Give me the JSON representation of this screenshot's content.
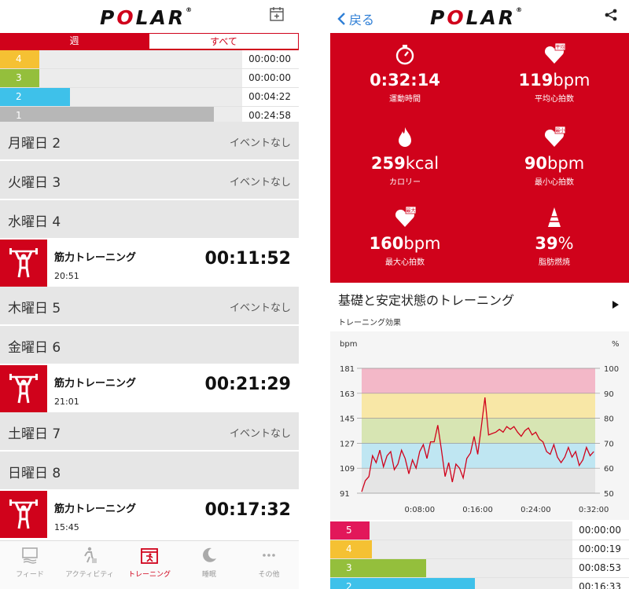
{
  "colors": {
    "brand": "#d0021b",
    "zone5": "#e2175a",
    "zone4": "#f5c133",
    "zone3": "#94bf3c",
    "zone2": "#3ec1ea",
    "zone1": "#b7b7b7"
  },
  "left": {
    "header": {
      "logo": "POLAR",
      "calendar_icon": "calendar-add-icon"
    },
    "tabs": [
      {
        "label": "週",
        "active": true
      },
      {
        "label": "すべて",
        "active": false
      }
    ],
    "zones": [
      {
        "zone": "4",
        "time": "00:00:00",
        "fraction": 0.0
      },
      {
        "zone": "3",
        "time": "00:00:00",
        "fraction": 0.0
      },
      {
        "zone": "2",
        "time": "00:04:22",
        "fraction": 0.15
      },
      {
        "zone": "1",
        "time": "00:24:58",
        "fraction": 0.86
      }
    ],
    "days": [
      {
        "label": "月曜日 2",
        "status": "イベントなし"
      },
      {
        "label": "火曜日 3",
        "status": "イベントなし"
      },
      {
        "label": "水曜日 4"
      },
      {
        "label": "木曜日 5",
        "status": "イベントなし"
      },
      {
        "label": "金曜日 6"
      },
      {
        "label": "土曜日 7",
        "status": "イベントなし"
      },
      {
        "label": "日曜日 8"
      }
    ],
    "sessions": [
      {
        "name": "筋力トレーニング",
        "start": "20:51",
        "duration": "00:11:52"
      },
      {
        "name": "筋力トレーニング",
        "start": "21:01",
        "duration": "00:21:29"
      },
      {
        "name": "筋力トレーニング",
        "start": "15:45",
        "duration": "00:17:32"
      }
    ],
    "nav": [
      {
        "label": "フィード",
        "icon": "feed-icon",
        "active": false
      },
      {
        "label": "アクティビティ",
        "icon": "activity-icon",
        "active": false
      },
      {
        "label": "トレーニング",
        "icon": "training-icon",
        "active": true
      },
      {
        "label": "睡眠",
        "icon": "sleep-icon",
        "active": false
      },
      {
        "label": "その他",
        "icon": "more-icon",
        "active": false
      }
    ]
  },
  "right": {
    "header": {
      "back": "戻る",
      "logo": "POLAR",
      "share_icon": "share-icon"
    },
    "stats": [
      {
        "icon": "stopwatch-icon",
        "value": "0:32:14",
        "unit": "",
        "label": "運動時間"
      },
      {
        "icon": "heart-average-icon",
        "badge": "平均",
        "value": "119",
        "unit": "bpm",
        "label": "平均心拍数"
      },
      {
        "icon": "flame-icon",
        "value": "259",
        "unit": "kcal",
        "label": "カロリー"
      },
      {
        "icon": "heart-min-icon",
        "badge": "最小",
        "value": "90",
        "unit": "bpm",
        "label": "最小心拍数"
      },
      {
        "icon": "heart-max-icon",
        "badge": "最大",
        "value": "160",
        "unit": "bpm",
        "label": "最大心拍数"
      },
      {
        "icon": "fat-burn-icon",
        "value": "39",
        "unit": "%",
        "label": "脂肪燃焼"
      }
    ],
    "training_title": "基礎と安定状態のトレーニング",
    "training_sub": "トレーニング効果",
    "zones": [
      {
        "zone": "5",
        "time": "00:00:00",
        "fraction": 0.0
      },
      {
        "zone": "4",
        "time": "00:00:19",
        "fraction": 0.01
      },
      {
        "zone": "3",
        "time": "00:08:53",
        "fraction": 0.28
      },
      {
        "zone": "2",
        "time": "00:16:33",
        "fraction": 0.52
      }
    ]
  },
  "chart_data": {
    "type": "line",
    "ylabel": "bpm",
    "ylabel_right": "%",
    "y_ticks": [
      91,
      109,
      127,
      145,
      163,
      181
    ],
    "y_ticks_right": [
      50,
      60,
      70,
      80,
      90,
      100
    ],
    "x_ticks": [
      "0:08:00",
      "0:16:00",
      "0:24:00",
      "0:32:00"
    ],
    "ylim": [
      91,
      181
    ],
    "xlim_minutes": [
      0,
      32.2
    ],
    "zones_bpm": [
      {
        "from": 163,
        "to": 181,
        "color": "#f3b8c8"
      },
      {
        "from": 145,
        "to": 163,
        "color": "#f8e7a6"
      },
      {
        "from": 127,
        "to": 145,
        "color": "#d7e5b3"
      },
      {
        "from": 109,
        "to": 127,
        "color": "#bfe6f2"
      },
      {
        "from": 91,
        "to": 109,
        "color": "#e5e5e5"
      }
    ],
    "series": [
      {
        "color": "#d0021b",
        "x_minutes": [
          0,
          0.5,
          1,
          1.5,
          2,
          2.5,
          3,
          3.5,
          4,
          4.5,
          5,
          5.5,
          6,
          6.5,
          7,
          7.5,
          8,
          8.5,
          9,
          9.5,
          10,
          10.5,
          11,
          11.5,
          12,
          12.5,
          13,
          13.5,
          14,
          14.5,
          15,
          15.5,
          16,
          16.5,
          17,
          17.5,
          18,
          18.5,
          19,
          19.5,
          20,
          20.5,
          21,
          21.5,
          22,
          22.5,
          23,
          23.5,
          24,
          24.5,
          25,
          25.5,
          26,
          26.5,
          27,
          27.5,
          28,
          28.5,
          29,
          29.5,
          30,
          30.5,
          31,
          31.5,
          32
        ],
        "values": [
          92,
          100,
          103,
          118,
          113,
          122,
          110,
          118,
          121,
          108,
          112,
          122,
          116,
          105,
          115,
          109,
          121,
          126,
          116,
          128,
          128,
          140,
          122,
          103,
          113,
          99,
          112,
          109,
          102,
          116,
          120,
          132,
          119,
          139,
          160,
          133,
          134,
          135,
          137,
          135,
          139,
          137,
          139,
          135,
          132,
          136,
          138,
          133,
          135,
          130,
          128,
          121,
          119,
          126,
          117,
          113,
          117,
          124,
          117,
          121,
          111,
          115,
          124,
          118,
          121
        ]
      }
    ]
  }
}
